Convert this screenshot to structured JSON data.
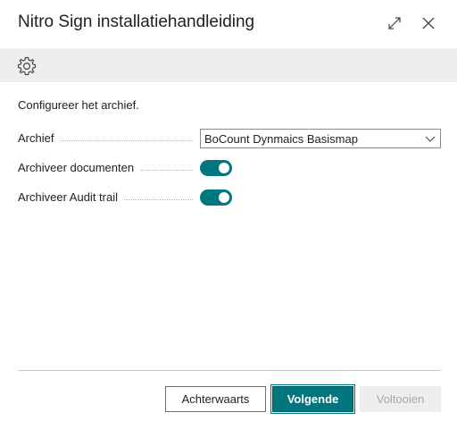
{
  "dialog": {
    "title": "Nitro Sign installatiehandleiding",
    "expand_icon": "expand-icon",
    "close_icon": "close-icon"
  },
  "toolbar": {
    "settings_icon": "gear-icon"
  },
  "content": {
    "intro": "Configureer het archief.",
    "fields": {
      "archive": {
        "label": "Archief",
        "value": "BoCount Dynmaics Basismap"
      },
      "archive_documents": {
        "label": "Archiveer documenten",
        "on": true
      },
      "archive_audit_trail": {
        "label": "Archiveer Audit trail",
        "on": true
      }
    }
  },
  "footer": {
    "back_label": "Achterwaarts",
    "next_label": "Volgende",
    "finish_label": "Voltooien",
    "finish_enabled": false
  },
  "colors": {
    "accent": "#00767f",
    "toolbar_bg": "#eeeeee",
    "disabled_text": "#a6a6a6"
  }
}
